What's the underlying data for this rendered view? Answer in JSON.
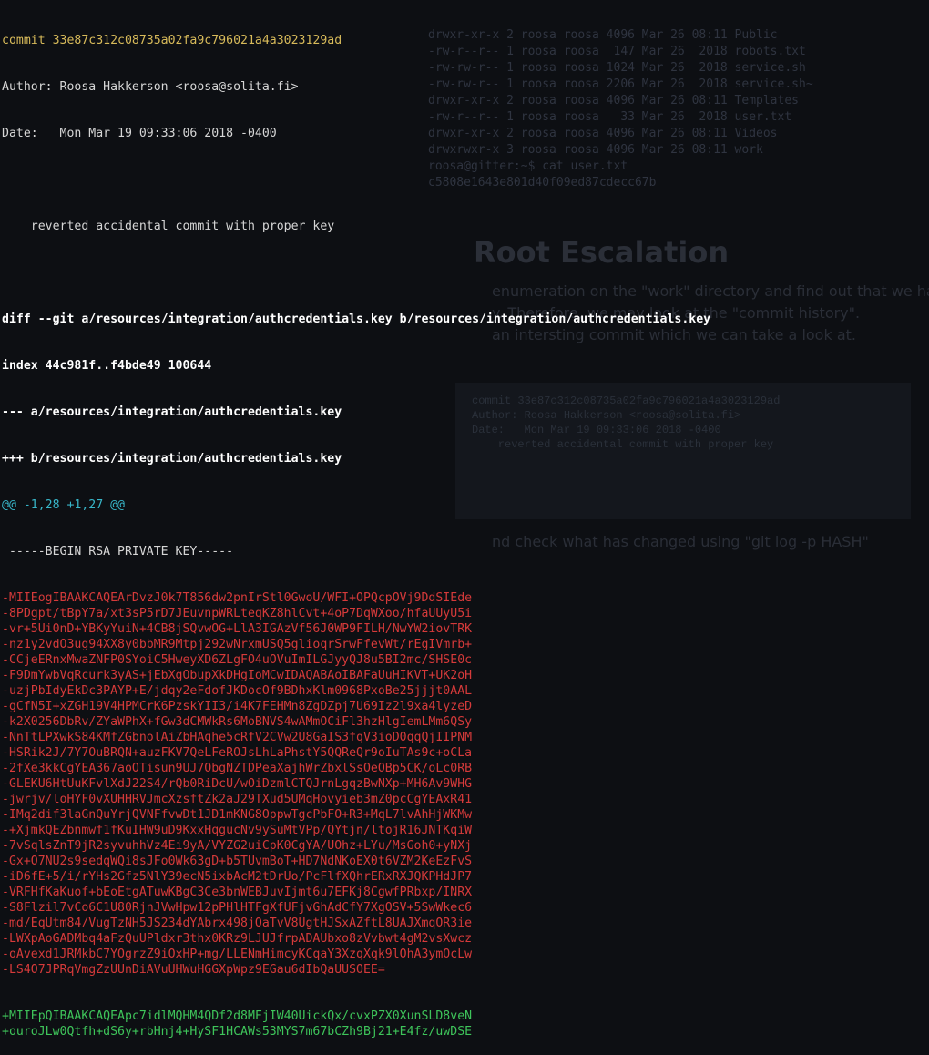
{
  "background_ghost": {
    "ls_lines": [
      "drwxr-xr-x 2 roosa roosa 4096 Mar 26 08:11 Public",
      "-rw-r--r-- 1 roosa roosa  147 Mar 26  2018 robots.txt",
      "-rw-rw-r-- 1 roosa roosa 1024 Mar 26  2018 service.sh",
      "-rw-rw-r-- 1 roosa roosa 2206 Mar 26  2018 service.sh~",
      "drwxr-xr-x 2 roosa roosa 4096 Mar 26 08:11 Templates",
      "-rw-r--r-- 1 roosa roosa   33 Mar 26  2018 user.txt",
      "drwxr-xr-x 2 roosa roosa 4096 Mar 26 08:11 Videos",
      "drwxrwxr-x 3 roosa roosa 4096 Mar 26 08:11 work",
      "roosa@gitter:~$ cat user.txt",
      "c5808e1643e801d40f09ed87cdecc67b"
    ],
    "heading": "Root Escalation",
    "paragraph": [
      "enumeration on the \"work\" directory and find out that we have",
      "y. Therefore, we may look at the \"commit history\".",
      "",
      "an intersting commit which we can take a look at."
    ],
    "code_lines": [
      "commit 33e87c312c08735a02fa9c796021a4a3023129ad",
      "Author: Roosa Hakkerson <roosa@solita.fi>",
      "Date:   Mon Mar 19 09:33:06 2018 -0400",
      "",
      "    reverted accidental commit with proper key"
    ],
    "tail": "nd check what has changed using \"git log -p HASH\""
  },
  "terminal": {
    "commit_line": "commit 33e87c312c08735a02fa9c796021a4a3023129ad",
    "author_line": "Author: Roosa Hakkerson <roosa@solita.fi>",
    "date_line": "Date:   Mon Mar 19 09:33:06 2018 -0400",
    "message_line": "    reverted accidental commit with proper key",
    "diff_header": "diff --git a/resources/integration/authcredentials.key b/resources/integration/authcredentials.key",
    "index_line": "index 44c981f..f4bde49 100644",
    "minus_file": "--- a/resources/integration/authcredentials.key",
    "plus_file": "+++ b/resources/integration/authcredentials.key",
    "hunk": "@@ -1,28 +1,27 @@",
    "context_line": " -----BEGIN RSA PRIVATE KEY-----",
    "removed_lines": [
      "-MIIEogIBAAKCAQEArDvzJ0k7T856dw2pnIrStl0GwoU/WFI+OPQcpOVj9DdSIEde",
      "-8PDgpt/tBpY7a/xt3sP5rD7JEuvnpWRLteqKZ8hlCvt+4oP7DqWXoo/hfaUUyU5i",
      "-vr+5Ui0nD+YBKyYuiN+4CB8jSQvwOG+LlA3IGAzVf56J0WP9FILH/NwYW2iovTRK",
      "-nz1y2vdO3ug94XX8y0bbMR9Mtpj292wNrxmUSQ5glioqrSrwFfevWt/rEgIVmrb+",
      "-CCjeERnxMwaZNFP0SYoiC5HweyXD6ZLgFO4uOVuImILGJyyQJ8u5BI2mc/SHSE0c",
      "-F9DmYwbVqRcurk3yAS+jEbXgObupXkDHgIoMCwIDAQABAoIBAFaUuHIKVT+UK2oH",
      "-uzjPbIdyEkDc3PAYP+E/jdqy2eFdofJKDocOf9BDhxKlm0968PxoBe25jjjt0AAL",
      "-gCfN5I+xZGH19V4HPMCrK6PzskYII3/i4K7FEHMn8ZgDZpj7U69Iz2l9xa4lyzeD",
      "-k2X0256DbRv/ZYaWPhX+fGw3dCMWkRs6MoBNVS4wAMmOCiFl3hzHlgIemLMm6QSy",
      "-NnTtLPXwkS84KMfZGbnolAiZbHAqhe5cRfV2CVw2U8GaIS3fqV3ioD0qqQjIIPNM",
      "-HSRik2J/7Y7OuBRQN+auzFKV7QeLFeROJsLhLaPhstY5QQReQr9oIuTAs9c+oCLa",
      "-2fXe3kkCgYEA367aoOTisun9UJ7ObgNZTDPeaXajhWrZbxlSsOeOBp5CK/oLc0RB",
      "-GLEKU6HtUuKFvlXdJ22S4/rQb0RiDcU/wOiDzmlCTQJrnLgqzBwNXp+MH6Av9WHG",
      "-jwrjv/loHYF0vXUHHRVJmcXzsftZk2aJ29TXud5UMqHovyieb3mZ0pcCgYEAxR41",
      "-IMq2dif3laGnQuYrjQVNFfvwDt1JD1mKNG8OppwTgcPbFO+R3+MqL7lvAhHjWKMw",
      "-+XjmkQEZbnmwf1fKuIHW9uD9KxxHqgucNv9ySuMtVPp/QYtjn/ltojR16JNTKqiW",
      "-7vSqlsZnT9jR2syvuhhVz4Ei9yA/VYZG2uiCpK0CgYA/UOhz+LYu/MsGoh0+yNXj",
      "-Gx+O7NU2s9sedqWQi8sJFo0Wk63gD+b5TUvmBoT+HD7NdNKoEX0t6VZM2KeEzFvS",
      "-iD6fE+5/i/rYHs2Gfz5NlY39ecN5ixbAcM2tDrUo/PcFlfXQhrERxRXJQKPHdJP7",
      "-VRFHfKaKuof+bEoEtgATuwKBgC3Ce3bnWEBJuvIjmt6u7EFKj8CgwfPRbxp/INRX",
      "-S8Flzil7vCo6C1U80RjnJVwHpw12pPHlHTFgXfUFjvGhAdCfY7XgOSV+5SwWkec6",
      "-md/EqUtm84/VugTzNH5JS234dYAbrx498jQaTvV8UgtHJSxAZftL8UAJXmqOR3ie",
      "-LWXpAoGADMbq4aFzQuUPldxr3thx0KRz9LJUJfrpADAUbxo8zVvbwt4gM2vsXwcz",
      "-oAvexd1JRMkbC7YOgrzZ9iOxHP+mg/LLENmHimcyKCqaY3XzqXqk9lOhA3ymOcLw",
      "-LS4O7JPRqVmgZzUUnDiAVuUHWuHGGXpWpz9EGau6dIbQaUUSOEE="
    ],
    "added_lines": [
      "+MIIEpQIBAAKCAQEApc7idlMQHM4QDf2d8MFjIW40UickQx/cvxPZX0XunSLD8veN",
      "+ouroJLw0Qtfh+dS6y+rbHnj4+HySF1HCAWs53MYS7m67bCZh9Bj21+E4fz/uwDSE"
    ]
  }
}
